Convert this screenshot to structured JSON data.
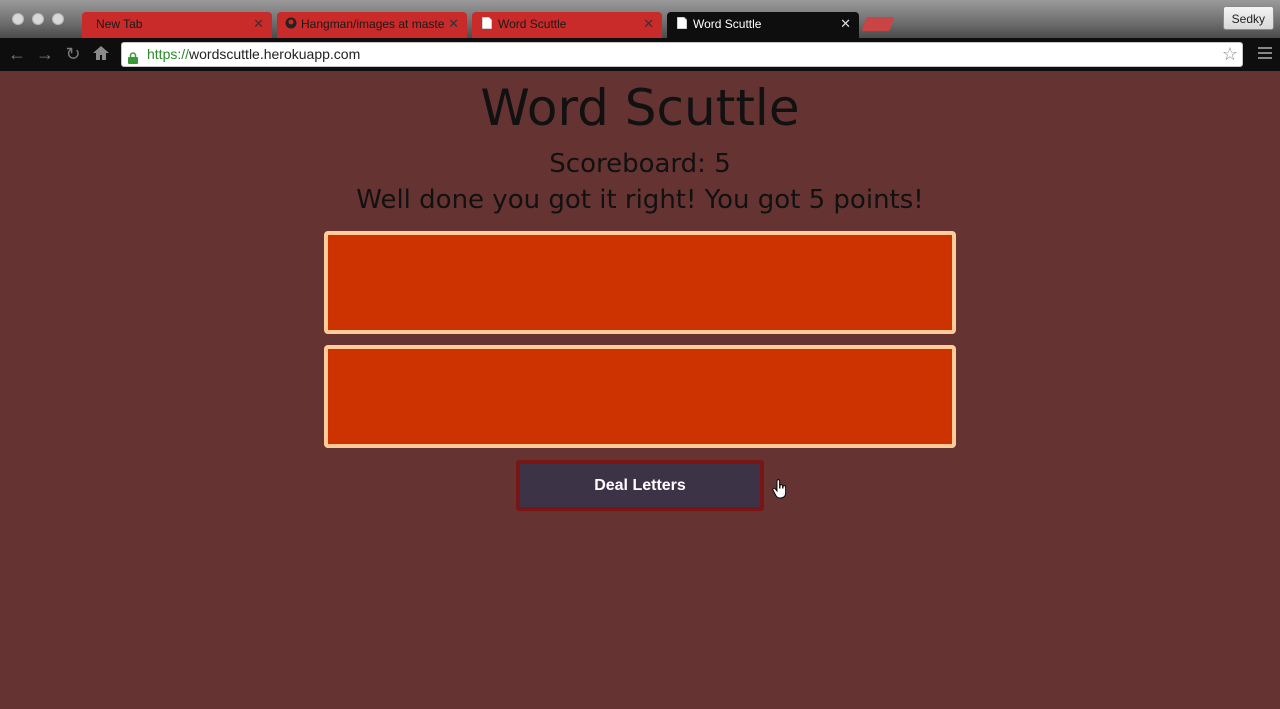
{
  "browser": {
    "tabs": [
      {
        "label": "New Tab",
        "active": false
      },
      {
        "label": "Hangman/images at maste",
        "active": false
      },
      {
        "label": "Word Scuttle",
        "active": false
      },
      {
        "label": "Word Scuttle",
        "active": true
      }
    ],
    "profile_name": "Sedky",
    "url_scheme": "https://",
    "url_host": "wordscuttle.herokuapp.com"
  },
  "page": {
    "title": "Word Scuttle",
    "scoreboard": "Scoreboard: 5",
    "message": "Well done you got it right! You got 5 points!",
    "deal_button_label": "Deal Letters"
  },
  "colors": {
    "background": "#663333",
    "letter_box_fill": "#cc3300",
    "letter_box_border": "#ffcc99",
    "button_fill": "#3d3346",
    "button_border": "#7a1515"
  }
}
